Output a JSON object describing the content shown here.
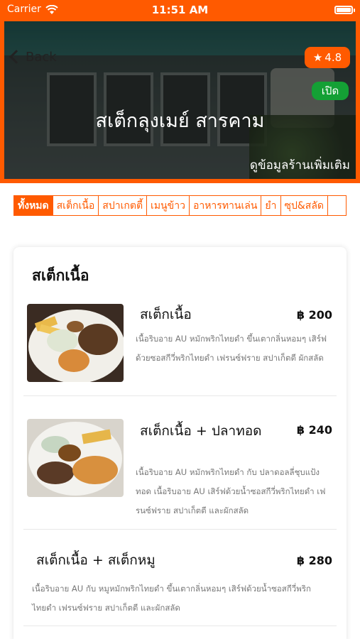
{
  "status_bar": {
    "carrier": "Carrier",
    "time": "11:51 AM"
  },
  "header": {
    "back_label": "Back",
    "rating": "4.8",
    "status": "เปิด",
    "shop_name": "สเต็กลุงเมย์ สารคาม",
    "more_info": "ดูข้อมูลร้านเพิ่มเติม"
  },
  "tabs": [
    "ทั้งหมด",
    "สเต็กเนื้อ",
    "สปาเกตตี้",
    "เมนูข้าว",
    "อาหารทานเล่น",
    "ยำ",
    "ซุป&สลัด"
  ],
  "active_tab": 0,
  "section": {
    "title": "สเต็กเนื้อ"
  },
  "items": [
    {
      "name": "สเต็กเนื้อ",
      "price": "฿ 200",
      "description": "เนื้อริบอาย AU หมักพริกไทยดำ ขึ้นเตากลิ่นหอมๆ เสิร์ฟด้วยซอสกีวี่พริกไทยดำ เฟรนซ์ฟราย สปาเก็ตตี ผักสลัด"
    },
    {
      "name": "สเต็กเนื้อ + ปลาทอด",
      "price": "฿ 240",
      "description": "เนื้อริบอาย AU หมักพริกไทยดำ กับ ปลาดอลลี่ชุบแป้งทอด เนื้อริบอาย AU เสิร์ฟด้วยน้ำซอสกีวี่พริกไทยดำ เฟรนซ์ฟราย สปาเก็ตตี และผักสลัด"
    },
    {
      "name": "สเต็กเนื้อ + สเต็กหมู",
      "price": "฿ 280",
      "description": "เนื้อริบอาย AU กับ หมูหมักพริกไทยดำ ขึ้นเตากลิ่นหอมๆ เสิร์ฟด้วยน้ำซอสกีวี่พริกไทยดำ เฟรนซ์ฟราย สปาเก็ตตี และผักสลัด"
    }
  ],
  "colors": {
    "accent": "#ff5a00",
    "open": "#14a035"
  },
  "icons": {
    "wifi": "wifi-icon",
    "battery": "battery-icon",
    "back": "chevron-left-icon",
    "star": "star-icon"
  }
}
